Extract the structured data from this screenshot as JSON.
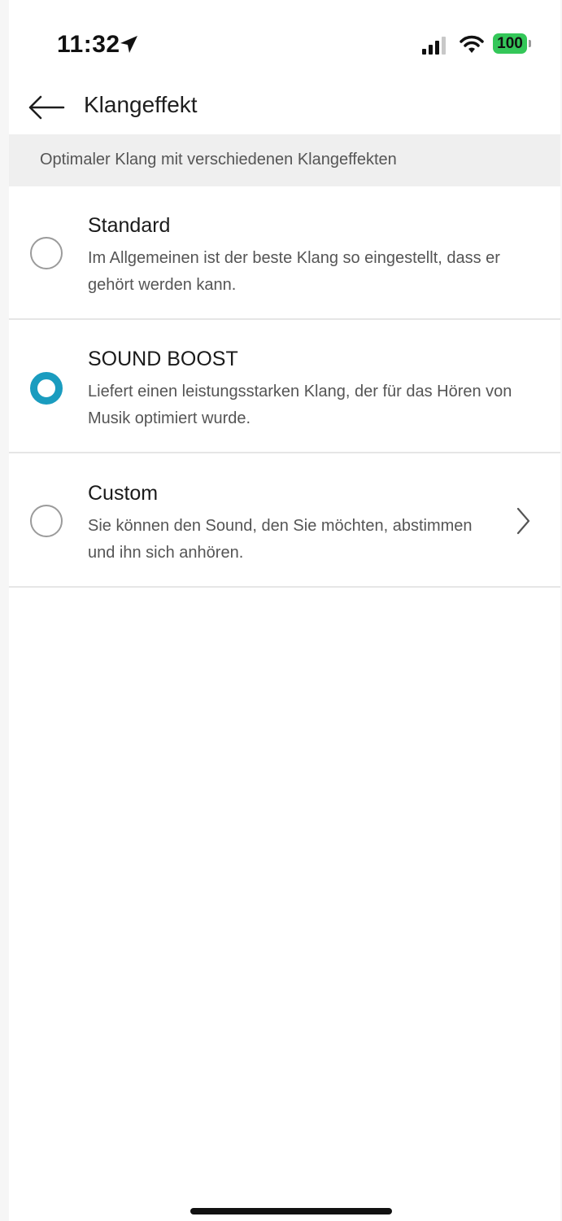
{
  "status_bar": {
    "time": "11:32",
    "battery_level": "100",
    "battery_color": "#34c759",
    "icons": [
      "location-arrow-icon",
      "cellular-signal-icon",
      "wifi-icon",
      "battery-icon"
    ]
  },
  "header": {
    "back_icon": "arrow-left-icon",
    "title": "Klangeffekt"
  },
  "subtitle": "Optimaler Klang mit verschiedenen Klangeffekten",
  "options": [
    {
      "title": "Standard",
      "description": "Im Allgemeinen ist der beste Klang so eingestellt, dass er gehört werden kann.",
      "selected": false
    },
    {
      "title": "SOUND BOOST",
      "description": "Liefert einen leistungsstarken Klang, der für das Hören von Musik optimiert wurde.",
      "selected": true
    },
    {
      "title": "Custom",
      "description": "Sie können den Sound, den Sie möchten, abstimmen und ihn sich anhören.",
      "selected": false,
      "has_chevron": true
    }
  ],
  "colors": {
    "accent": "#1a9cbf",
    "subtitle_band": "#efefef",
    "radio_off": "#9b9b9b"
  }
}
